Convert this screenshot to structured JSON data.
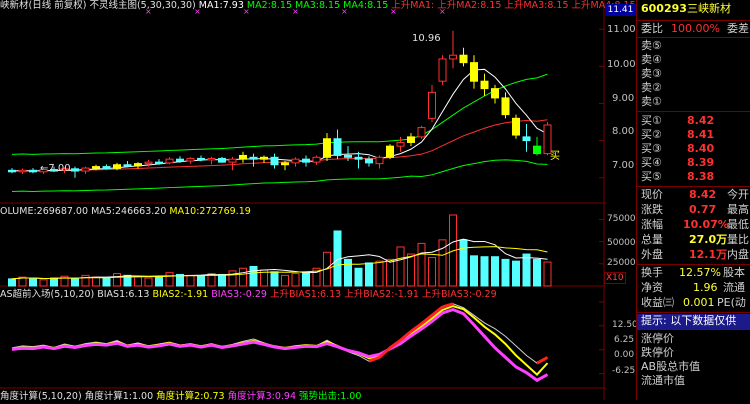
{
  "main_header": {
    "title": "峡新材(日线 前复权)",
    "indicator": "不灵线主图(5,30,30,30)",
    "ma1": "MA1:7.93",
    "ma2": "MA2:8.15",
    "ma3": "MA3:8.15",
    "ma4": "MA4:8.15",
    "up_ma1": "上升MA1:",
    "up_ma2": "上升MA2:8.15",
    "up_ma3": "上升MA3:8.15",
    "up_ma4": "上升MA4:8.15"
  },
  "volume_header": {
    "volume": "OLUME:269687.00",
    "ma5": "MA5:246663.20",
    "ma10": "MA10:272769.19"
  },
  "bias_header": {
    "name": "AS超前入场(5,10,20)",
    "bias1": "BIAS1:6.13",
    "bias2": "BIAS2:-1.91",
    "bias3": "BIAS3:-0.29",
    "up_bias1": "上升BIAS1:6.13",
    "up_bias2": "上升BIAS2:-1.91",
    "up_bias3": "上升BIAS3:-0.29"
  },
  "angle_header": {
    "name": "角度计算(5,10,20)",
    "angle1": "角度计算1:1.00",
    "angle2": "角度计算2:0.73",
    "angle3": "角度计算3:0.94",
    "strong": "强势出击:1.00"
  },
  "annotations": {
    "high": "10.96",
    "low": "7.00",
    "buy_mark": "买"
  },
  "price_axis": [
    "11.00",
    "10.00",
    "9.00",
    "8.00",
    "7.00"
  ],
  "price_axis_top": "11.41",
  "volume_axis": [
    "75000",
    "50000",
    "25000"
  ],
  "volume_unit": "X10",
  "bias_axis": [
    "12.50",
    "6.25",
    "0.00",
    "-6.25"
  ],
  "stock": {
    "code": "600293",
    "name": "三峡新材"
  },
  "order_book": {
    "ratio_label": "委比",
    "ratio_value": "100.00%",
    "diff_label": "委差",
    "sells": [
      {
        "label": "卖⑤",
        "price": "",
        "vol": ""
      },
      {
        "label": "卖④",
        "price": "",
        "vol": ""
      },
      {
        "label": "卖③",
        "price": "",
        "vol": ""
      },
      {
        "label": "卖②",
        "price": "",
        "vol": ""
      },
      {
        "label": "卖①",
        "price": "",
        "vol": ""
      }
    ],
    "buys": [
      {
        "label": "买①",
        "price": "8.42",
        "vol": ""
      },
      {
        "label": "买②",
        "price": "8.41",
        "vol": ""
      },
      {
        "label": "买③",
        "price": "8.40",
        "vol": ""
      },
      {
        "label": "买④",
        "price": "8.39",
        "vol": ""
      },
      {
        "label": "买⑤",
        "price": "8.38",
        "vol": ""
      }
    ]
  },
  "quote": [
    {
      "l": "现价",
      "v": "8.42",
      "r": "今开"
    },
    {
      "l": "涨跌",
      "v": "0.77",
      "r": "最高"
    },
    {
      "l": "涨幅",
      "v": "10.07%",
      "r": "最低"
    },
    {
      "l": "总量",
      "v": "27.0万",
      "r": "量比"
    },
    {
      "l": "外盘",
      "v": "12.1万",
      "r": "内盘"
    }
  ],
  "quote2": [
    {
      "l": "换手",
      "v": "12.57%",
      "r": "股本"
    },
    {
      "l": "净资",
      "v": "1.96",
      "r": "流通"
    },
    {
      "l": "收益㈢",
      "v": "0.001",
      "r": "PE(动"
    }
  ],
  "hint": "提示: 以下数据仅供",
  "extra": [
    "涨停价",
    "跌停价",
    "AB股总市值",
    "流通市值"
  ],
  "colors": {
    "up": "#ff3030",
    "down": "#54ffff",
    "yellow": "#ffff00",
    "magenta": "#ff40ff",
    "green": "#00ff00"
  },
  "chart_data": [
    {
      "type": "candlestick",
      "title": "不灵线主图",
      "ylim": [
        6.4,
        11.41
      ],
      "candles_ohlc": [
        [
          7.2,
          7.26,
          7.12,
          7.18
        ],
        [
          7.18,
          7.25,
          7.1,
          7.2
        ],
        [
          7.2,
          7.26,
          7.12,
          7.16
        ],
        [
          7.16,
          7.25,
          7.1,
          7.22
        ],
        [
          7.22,
          7.3,
          7.15,
          7.2
        ],
        [
          7.2,
          7.28,
          7.12,
          7.24
        ],
        [
          7.24,
          7.3,
          7.0,
          7.18
        ],
        [
          7.18,
          7.3,
          7.1,
          7.26
        ],
        [
          7.26,
          7.35,
          7.2,
          7.3
        ],
        [
          7.3,
          7.36,
          7.22,
          7.25
        ],
        [
          7.25,
          7.4,
          7.2,
          7.35
        ],
        [
          7.35,
          7.45,
          7.28,
          7.32
        ],
        [
          7.32,
          7.42,
          7.25,
          7.38
        ],
        [
          7.38,
          7.48,
          7.3,
          7.42
        ],
        [
          7.42,
          7.5,
          7.35,
          7.4
        ],
        [
          7.4,
          7.55,
          7.36,
          7.5
        ],
        [
          7.5,
          7.58,
          7.4,
          7.45
        ],
        [
          7.45,
          7.55,
          7.38,
          7.52
        ],
        [
          7.52,
          7.6,
          7.44,
          7.48
        ],
        [
          7.48,
          7.56,
          7.36,
          7.52
        ],
        [
          7.52,
          7.56,
          7.4,
          7.42
        ],
        [
          7.42,
          7.56,
          7.2,
          7.5
        ],
        [
          7.5,
          7.7,
          7.4,
          7.6
        ],
        [
          7.55,
          7.65,
          7.3,
          7.5
        ],
        [
          7.5,
          7.6,
          7.4,
          7.55
        ],
        [
          7.55,
          7.65,
          7.25,
          7.35
        ],
        [
          7.35,
          7.45,
          7.2,
          7.4
        ],
        [
          7.4,
          7.55,
          7.3,
          7.5
        ],
        [
          7.5,
          7.6,
          7.3,
          7.42
        ],
        [
          7.42,
          7.6,
          7.35,
          7.55
        ],
        [
          7.55,
          8.2,
          7.45,
          8.05
        ],
        [
          8.05,
          8.3,
          7.5,
          7.6
        ],
        [
          7.6,
          7.85,
          7.45,
          7.55
        ],
        [
          7.55,
          7.7,
          7.25,
          7.5
        ],
        [
          7.5,
          7.58,
          7.3,
          7.4
        ],
        [
          7.38,
          7.6,
          7.25,
          7.55
        ],
        [
          7.55,
          7.9,
          7.5,
          7.85
        ],
        [
          7.85,
          8.1,
          7.7,
          7.95
        ],
        [
          7.95,
          8.2,
          7.85,
          8.1
        ],
        [
          8.1,
          8.4,
          8.05,
          8.35
        ],
        [
          8.6,
          9.5,
          8.5,
          9.3
        ],
        [
          9.6,
          10.3,
          9.5,
          10.2
        ],
        [
          10.2,
          10.96,
          9.95,
          10.3
        ],
        [
          10.3,
          10.5,
          10.0,
          10.1
        ],
        [
          10.1,
          10.3,
          9.4,
          9.6
        ],
        [
          9.6,
          9.8,
          9.2,
          9.4
        ],
        [
          9.4,
          9.5,
          9.0,
          9.15
        ],
        [
          9.15,
          9.3,
          8.6,
          8.7
        ],
        [
          8.6,
          8.7,
          8.05,
          8.15
        ],
        [
          8.1,
          8.45,
          7.7,
          8.0
        ],
        [
          7.85,
          8.1,
          7.6,
          7.65
        ],
        [
          7.65,
          8.5,
          7.6,
          8.42
        ]
      ]
    },
    {
      "type": "bar",
      "title": "VOLUME",
      "ylim": [
        0,
        80000
      ],
      "values": [
        8000,
        10000,
        9000,
        7000,
        9000,
        11000,
        8000,
        12000,
        10000,
        9000,
        14000,
        12000,
        11000,
        9000,
        10000,
        15000,
        13000,
        12000,
        11000,
        14000,
        13000,
        17000,
        20000,
        22000,
        18000,
        16000,
        12000,
        14000,
        15000,
        20000,
        38000,
        62000,
        30000,
        20000,
        26000,
        28000,
        30000,
        44000,
        36000,
        48000,
        32000,
        52000,
        80000,
        52000,
        34000,
        33000,
        33000,
        30000,
        28000,
        36000,
        30000,
        27000
      ]
    },
    {
      "type": "line",
      "title": "AS超前入场 BIAS",
      "ylim": [
        -10,
        13
      ],
      "series": [
        {
          "name": "BIAS1",
          "values": [
            0.5,
            1.0,
            0.8,
            1.2,
            0.6,
            1.5,
            0.9,
            1.6,
            2.0,
            1.6,
            2.4,
            1.2,
            1.8,
            1.0,
            1.5,
            2.0,
            1.2,
            1.6,
            1.0,
            1.6,
            0.8,
            1.4,
            2.2,
            2.8,
            1.8,
            0.8,
            0.4,
            0.8,
            1.2,
            1.0,
            2.5,
            1.0,
            -0.5,
            -1.5,
            -3.0,
            -2.0,
            0.5,
            2.5,
            4.8,
            6.8,
            9.0,
            11.2,
            12.0,
            11.0,
            9.0,
            7.0,
            5.5,
            3.5,
            1.0,
            -1.5,
            -3.5,
            -2.0
          ]
        },
        {
          "name": "BIAS2",
          "values": [
            0.2,
            0.6,
            0.5,
            0.9,
            0.5,
            1.1,
            0.8,
            1.3,
            1.7,
            1.4,
            2.0,
            1.1,
            1.5,
            0.9,
            1.3,
            1.8,
            1.1,
            1.4,
            0.9,
            1.4,
            0.8,
            1.2,
            1.8,
            2.3,
            1.6,
            0.9,
            0.5,
            0.9,
            1.2,
            1.0,
            2.1,
            1.0,
            -0.3,
            -1.0,
            -2.2,
            -1.5,
            0.3,
            2.0,
            4.2,
            6.1,
            8.2,
            10.4,
            11.4,
            10.6,
            8.4,
            6.0,
            4.0,
            1.5,
            -1.5,
            -4.0,
            -6.5,
            -3.5
          ]
        },
        {
          "name": "BIAS3",
          "values": [
            0.1,
            0.4,
            0.3,
            0.7,
            0.3,
            0.9,
            0.6,
            1.1,
            1.4,
            1.2,
            1.7,
            0.9,
            1.2,
            0.7,
            1.0,
            1.5,
            0.9,
            1.2,
            0.7,
            1.2,
            0.6,
            1.0,
            1.5,
            2.0,
            1.4,
            0.7,
            0.3,
            0.6,
            0.9,
            0.8,
            1.6,
            0.8,
            -0.2,
            -0.8,
            -1.8,
            -1.2,
            0.2,
            1.6,
            3.6,
            5.4,
            7.4,
            9.6,
            10.5,
            9.4,
            6.5,
            3.5,
            0.5,
            -2.0,
            -4.5,
            -6.0,
            -8.0,
            -6.5
          ]
        }
      ]
    }
  ]
}
